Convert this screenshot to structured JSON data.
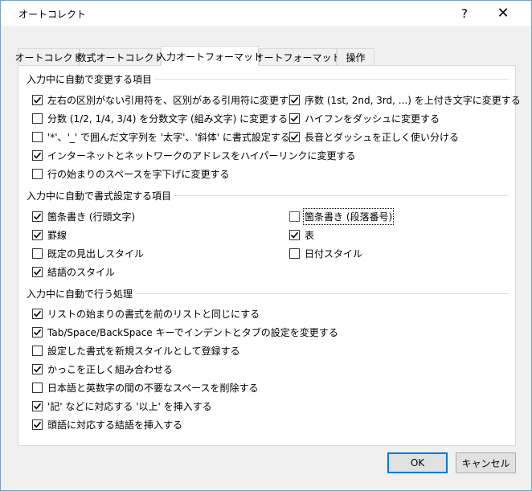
{
  "window": {
    "title": "オートコレクト",
    "help_label": "?",
    "close_label": "✕"
  },
  "tabs": [
    {
      "label": "オートコレクト",
      "active": false
    },
    {
      "label": "数式オートコレクト",
      "active": false
    },
    {
      "label": "入力オートフォーマット",
      "active": true
    },
    {
      "label": "オートフォーマット",
      "active": false
    },
    {
      "label": "操作",
      "active": false
    }
  ],
  "group1": {
    "title": "入力中に自動で変更する項目",
    "left": [
      {
        "label": "左右の区別がない引用符を、区別がある引用符に変更する",
        "checked": true
      },
      {
        "label": "分数 (1/2, 1/4, 3/4) を分数文字 (組み文字) に変更する",
        "checked": false
      },
      {
        "label": "'*'、'_' で囲んだ文字列を '太字'、'斜体' に書式設定する",
        "checked": false
      },
      {
        "label": "インターネットとネットワークのアドレスをハイパーリンクに変更する",
        "checked": true
      },
      {
        "label": "行の始まりのスペースを字下げに変更する",
        "checked": false
      }
    ],
    "right": [
      {
        "label": "序数 (1st, 2nd, 3rd, ...) を上付き文字に変更する",
        "checked": true
      },
      {
        "label": "ハイフンをダッシュに変更する",
        "checked": true
      },
      {
        "label": "長音とダッシュを正しく使い分ける",
        "checked": true
      }
    ]
  },
  "group2": {
    "title": "入力中に自動で書式設定する項目",
    "left": [
      {
        "label": "箇条書き (行頭文字)",
        "checked": true
      },
      {
        "label": "罫線",
        "checked": true
      },
      {
        "label": "既定の見出しスタイル",
        "checked": false
      },
      {
        "label": "結語のスタイル",
        "checked": true
      }
    ],
    "right": [
      {
        "label": "箇条書き (段落番号)",
        "checked": false
      },
      {
        "label": "表",
        "checked": true
      },
      {
        "label": "日付スタイル",
        "checked": false
      }
    ]
  },
  "group3": {
    "title": "入力中に自動で行う処理",
    "items": [
      {
        "label": "リストの始まりの書式を前のリストと同じにする",
        "checked": true
      },
      {
        "label": "Tab/Space/BackSpace キーでインデントとタブの設定を変更する",
        "checked": true
      },
      {
        "label": "設定した書式を新規スタイルとして登録する",
        "checked": false
      },
      {
        "label": "かっこを正しく組み合わせる",
        "checked": true
      },
      {
        "label": "日本語と英数字の間の不要なスペースを削除する",
        "checked": false
      },
      {
        "label": "'記' などに対応する '以上' を挿入する",
        "checked": true
      },
      {
        "label": "頭語に対応する結語を挿入する",
        "checked": true
      }
    ]
  },
  "buttons": {
    "ok_label": "OK",
    "cancel_label": "キャンセル"
  }
}
